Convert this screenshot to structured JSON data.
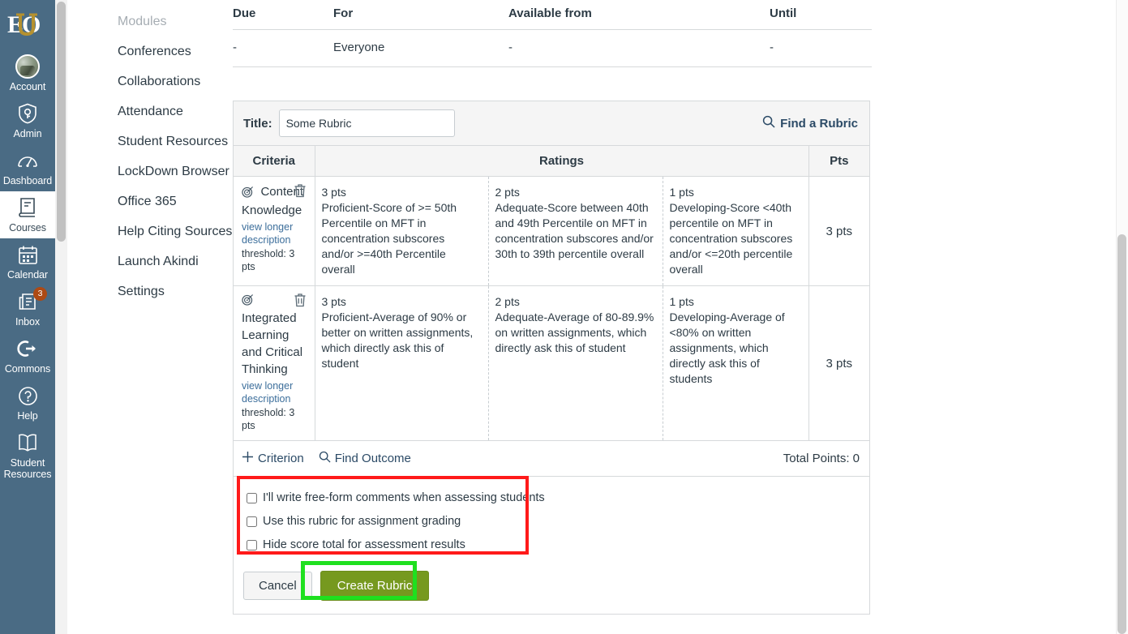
{
  "global_nav": {
    "logo": {
      "name": "eu-logo",
      "text": "EU"
    },
    "items": [
      {
        "label": "Account",
        "icon": "avatar",
        "active": false,
        "badge": null
      },
      {
        "label": "Admin",
        "icon": "shield-icon",
        "active": false,
        "badge": null
      },
      {
        "label": "Dashboard",
        "icon": "dashboard-icon",
        "active": false,
        "badge": null
      },
      {
        "label": "Courses",
        "icon": "courses-book-icon",
        "active": true,
        "badge": null
      },
      {
        "label": "Calendar",
        "icon": "calendar-icon",
        "active": false,
        "badge": null
      },
      {
        "label": "Inbox",
        "icon": "inbox-icon",
        "active": false,
        "badge": "3"
      },
      {
        "label": "Commons",
        "icon": "commons-arrow-icon",
        "active": false,
        "badge": null
      },
      {
        "label": "Help",
        "icon": "help-question-icon",
        "active": false,
        "badge": null
      },
      {
        "label": "Student Resources",
        "icon": "open-book-icon",
        "active": false,
        "badge": null
      }
    ]
  },
  "course_nav": {
    "items": [
      {
        "label": "Modules",
        "disabled": true
      },
      {
        "label": "Conferences",
        "disabled": false
      },
      {
        "label": "Collaborations",
        "disabled": false
      },
      {
        "label": "Attendance",
        "disabled": false
      },
      {
        "label": "Student Resources",
        "disabled": false
      },
      {
        "label": "LockDown Browser",
        "disabled": false
      },
      {
        "label": "Office 365",
        "disabled": false
      },
      {
        "label": "Help Citing Sources",
        "disabled": false
      },
      {
        "label": "Launch Akindi",
        "disabled": false
      },
      {
        "label": "Settings",
        "disabled": false
      }
    ]
  },
  "dates_table": {
    "headers": [
      "Due",
      "For",
      "Available from",
      "Until"
    ],
    "rows": [
      [
        "-",
        "Everyone",
        "-",
        "-"
      ]
    ]
  },
  "rubric": {
    "title_label": "Title:",
    "title_value": "Some Rubric",
    "title_placeholder": "",
    "find_rubric_label": "Find a Rubric",
    "columns": [
      "Criteria",
      "Ratings",
      "Pts"
    ],
    "criteria": [
      {
        "name": "Content Knowledge",
        "view_longer_description": "view longer description",
        "threshold": "threshold: 3 pts",
        "points": "3 pts",
        "ratings": [
          {
            "pts": "3 pts",
            "description": "Proficient-Score of >= 50th Percentile on MFT in concentration subscores and/or >=40th Percentile overall"
          },
          {
            "pts": "2 pts",
            "description": "Adequate-Score between 40th and 49th Percentile on MFT in concentration subscores and/or 30th to 39th percentile overall"
          },
          {
            "pts": "1 pts",
            "description": "Developing-Score <40th percentile on MFT in concentration subscores and/or <=20th percentile overall"
          }
        ]
      },
      {
        "name": "Integrated Learning and Critical Thinking",
        "view_longer_description": "view longer description",
        "threshold": "threshold: 3 pts",
        "points": "3 pts",
        "ratings": [
          {
            "pts": "3 pts",
            "description": "Proficient-Average of 90% or better on written assignments, which directly ask this of student"
          },
          {
            "pts": "2 pts",
            "description": "Adequate-Average of 80-89.9% on written assignments, which directly ask this of student"
          },
          {
            "pts": "1 pts",
            "description": "Developing-Average of <80% on written assignments, which directly ask this of students"
          }
        ]
      }
    ],
    "footer": {
      "add_criterion_label": "Criterion",
      "find_outcome_label": "Find Outcome",
      "total_points_label": "Total Points: 0"
    },
    "options": [
      {
        "label": "I'll write free-form comments when assessing students",
        "checked": false
      },
      {
        "label": "Use this rubric for assignment grading",
        "checked": false
      },
      {
        "label": "Hide score total for assessment results",
        "checked": false
      }
    ],
    "actions": {
      "cancel_label": "Cancel",
      "create_label": "Create Rubric"
    }
  },
  "colors": {
    "nav_background": "#4a6b84",
    "brand_gold": "#b5912f",
    "link": "#2b4a66",
    "create_button": "#76991f",
    "highlight_red": "#ff1a1a",
    "highlight_green": "#1fe01f",
    "badge": "#ad4a15"
  }
}
